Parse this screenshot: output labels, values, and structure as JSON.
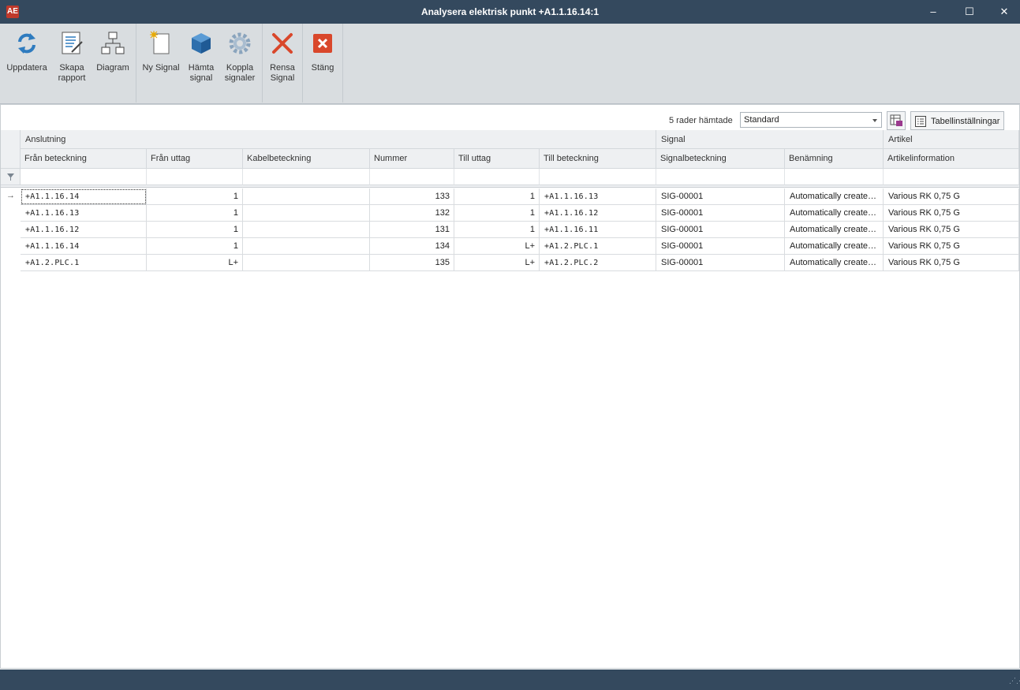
{
  "window": {
    "title": "Analysera elektrisk punkt +A1.1.16.14:1",
    "logo": "AE",
    "minimize": "–",
    "maximize": "☐",
    "close": "✕"
  },
  "ribbon": {
    "buttons": [
      {
        "key": "uppdatera",
        "label": "Uppdatera",
        "icon": "refresh-icon"
      },
      {
        "key": "skapa_rapport",
        "label": "Skapa\nrapport",
        "icon": "report-icon"
      },
      {
        "key": "diagram",
        "label": "Diagram",
        "icon": "diagram-icon"
      },
      {
        "key": "ny_signal",
        "label": "Ny Signal",
        "icon": "new-document-icon"
      },
      {
        "key": "hamta_signal",
        "label": "Hämta\nsignal",
        "icon": "cube-icon"
      },
      {
        "key": "koppla_signaler",
        "label": "Koppla\nsignaler",
        "icon": "gear-icon"
      },
      {
        "key": "rensa_signal",
        "label": "Rensa\nSignal",
        "icon": "clear-x-icon"
      },
      {
        "key": "stang",
        "label": "Stäng",
        "icon": "close-red-icon"
      }
    ]
  },
  "toolbar": {
    "rows_fetched": "5 rader hämtade",
    "layout_value": "Standard",
    "settings_label": "Tabellinställningar"
  },
  "grid": {
    "bands": [
      "Anslutning",
      "Signal",
      "Artikel"
    ],
    "columns": [
      "Från beteckning",
      "Från uttag",
      "Kabelbeteckning",
      "Nummer",
      "Till uttag",
      "Till beteckning",
      "Signalbeteckning",
      "Benämning",
      "Artikelinformation"
    ],
    "current_row_marker": "→",
    "rows": [
      [
        "+A1.1.16.14",
        "1",
        "",
        "133",
        "1",
        "+A1.1.16.13",
        "SIG-00001",
        "Automatically created...",
        "Various RK 0,75 G"
      ],
      [
        "+A1.1.16.13",
        "1",
        "",
        "132",
        "1",
        "+A1.1.16.12",
        "SIG-00001",
        "Automatically created...",
        "Various RK 0,75 G"
      ],
      [
        "+A1.1.16.12",
        "1",
        "",
        "131",
        "1",
        "+A1.1.16.11",
        "SIG-00001",
        "Automatically created...",
        "Various RK 0,75 G"
      ],
      [
        "+A1.1.16.14",
        "1",
        "",
        "134",
        "L+",
        "+A1.2.PLC.1",
        "SIG-00001",
        "Automatically created...",
        "Various RK 0,75 G"
      ],
      [
        "+A1.2.PLC.1",
        "L+",
        "",
        "135",
        "L+",
        "+A1.2.PLC.2",
        "SIG-00001",
        "Automatically created...",
        "Various RK 0,75 G"
      ]
    ]
  },
  "colors": {
    "titlebar": "#34495e",
    "ribbon": "#d9dde0",
    "accent_blue": "#2e7bbf",
    "danger_red": "#d9472b"
  }
}
